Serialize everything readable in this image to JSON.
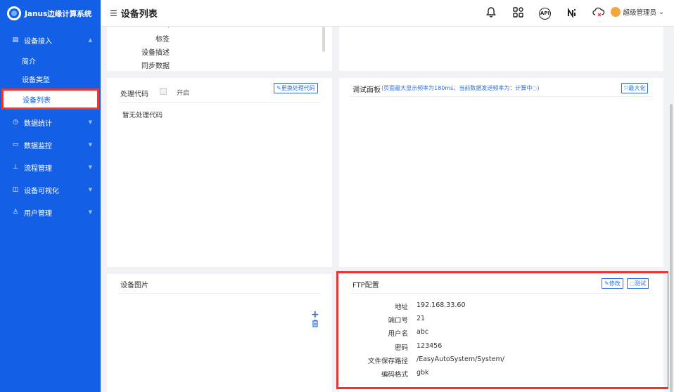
{
  "app": {
    "name": "Janus边缘计算系统"
  },
  "sidebar": {
    "groups": [
      {
        "label": "设备接入",
        "icon": "device-icon"
      },
      {
        "label": "数据统计",
        "icon": "clock-icon"
      },
      {
        "label": "数据监控",
        "icon": "monitor-icon"
      },
      {
        "label": "流程管理",
        "icon": "flow-icon"
      },
      {
        "label": "设备可视化",
        "icon": "visual-icon"
      },
      {
        "label": "用户管理",
        "icon": "user-icon"
      }
    ],
    "subitems": [
      {
        "label": "简介"
      },
      {
        "label": "设备类型"
      },
      {
        "label": "设备列表",
        "active": true
      }
    ]
  },
  "header": {
    "title": "设备列表",
    "user": "超级管理员",
    "api_label": "API"
  },
  "top_panel": {
    "fields": [
      "标签",
      "设备描述",
      "同步数据"
    ]
  },
  "process_code": {
    "title": "处理代码",
    "enable_label": "开启",
    "replace_button": "更换处理代码",
    "empty_text": "暂无处理代码"
  },
  "debug_panel": {
    "title": "调试面板",
    "note": "(页面最大显示频率为180ms，当前数据发送频率为：计算中◌)",
    "maximize_button": "最大化"
  },
  "device_image": {
    "title": "设备图片"
  },
  "ftp": {
    "title": "FTP配置",
    "edit_button": "修改",
    "test_button": "测试",
    "rows": [
      {
        "label": "地址",
        "value": "192.168.33.60"
      },
      {
        "label": "端口号",
        "value": "21"
      },
      {
        "label": "用户名",
        "value": "abc"
      },
      {
        "label": "密码",
        "value": "123456"
      },
      {
        "label": "文件保存路径",
        "value": "/EasyAutoSystem/System/"
      },
      {
        "label": "编码格式",
        "value": "gbk"
      }
    ]
  },
  "colors": {
    "brand": "#1360e6",
    "highlight": "#e53935",
    "accent": "#2c6fe0"
  }
}
